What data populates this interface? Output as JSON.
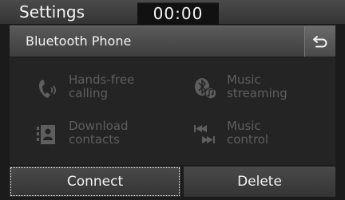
{
  "statusbar": {
    "title": "Settings",
    "clock": "00:00"
  },
  "header": {
    "title": "Bluetooth Phone"
  },
  "features": [
    {
      "label": "Hands-free\ncalling"
    },
    {
      "label": "Music\nstreaming"
    },
    {
      "label": "Download\ncontacts"
    },
    {
      "label": "Music\ncontrol"
    }
  ],
  "buttons": {
    "connect": "Connect",
    "delete": "Delete"
  },
  "colors": {
    "disabled_text": "#5e5e5e",
    "focus_outline": "#e8e8e8"
  }
}
